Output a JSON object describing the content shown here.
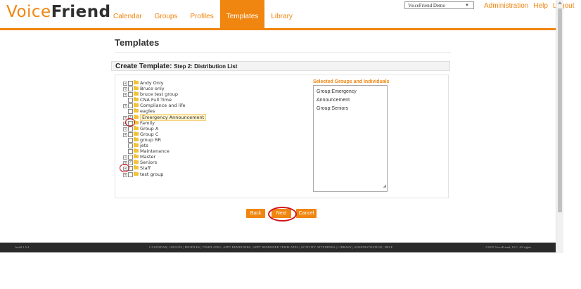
{
  "header": {
    "logo_voice": "Voice",
    "logo_friend": "Friend",
    "tabs": [
      {
        "label": "Calendar"
      },
      {
        "label": "Groups"
      },
      {
        "label": "Profiles"
      },
      {
        "label": "Templates"
      },
      {
        "label": "Library"
      }
    ],
    "active_tab": "Templates",
    "account_select": "VoiceFriend Demo",
    "links": {
      "administration": "Administration",
      "help": "Help",
      "logout": "Logout"
    }
  },
  "main": {
    "page_title": "Templates",
    "step_title": "Create Template:",
    "step_subtitle": "Step 2: Distribution List",
    "tree": [
      {
        "label": "Andy Only",
        "expandable": true,
        "checked": false
      },
      {
        "label": "Bruce only",
        "expandable": true,
        "checked": false
      },
      {
        "label": "bruce test group",
        "expandable": true,
        "checked": false
      },
      {
        "label": "CNA Full Time",
        "expandable": false,
        "checked": false
      },
      {
        "label": "Compliance and life",
        "expandable": true,
        "checked": false
      },
      {
        "label": "eagles",
        "expandable": false,
        "checked": false
      },
      {
        "label": "Emergency Announcement",
        "expandable": true,
        "checked": true,
        "highlighted": true
      },
      {
        "label": "Family",
        "expandable": true,
        "checked": false
      },
      {
        "label": "Group A",
        "expandable": true,
        "checked": false
      },
      {
        "label": "Group C",
        "expandable": true,
        "checked": false
      },
      {
        "label": "group RR",
        "expandable": false,
        "checked": false
      },
      {
        "label": "jets",
        "expandable": false,
        "checked": false
      },
      {
        "label": "Maintenance",
        "expandable": false,
        "checked": false
      },
      {
        "label": "Master",
        "expandable": true,
        "checked": false
      },
      {
        "label": "Seniors",
        "expandable": true,
        "checked": true
      },
      {
        "label": "Staff",
        "expandable": true,
        "checked": false
      },
      {
        "label": "test group",
        "expandable": true,
        "checked": false
      }
    ],
    "selected_title": "Selected Groups and Individuals",
    "selected_lines": [
      "Group:Emergency",
      "Announcement",
      "Group:Seniors"
    ],
    "buttons": {
      "back": "Back",
      "next": "Next",
      "cancel": "Cancel"
    }
  },
  "footer": {
    "build": "build 1.5.4",
    "links": "CALENDAR | GROUPS | PROFILES | TEMPLATES | APPT REMINDERS | APPT REMINDER TEMPLATES | ACTIVITY ATTENDEES | LIBRARY | ADMINISTRATION | HELP",
    "copyright": "©2019 VoiceFriend, LLC. All rights"
  },
  "colors": {
    "accent": "#f0850f",
    "annotation": "#d0151d",
    "footer_bg": "#2a2a2a"
  }
}
